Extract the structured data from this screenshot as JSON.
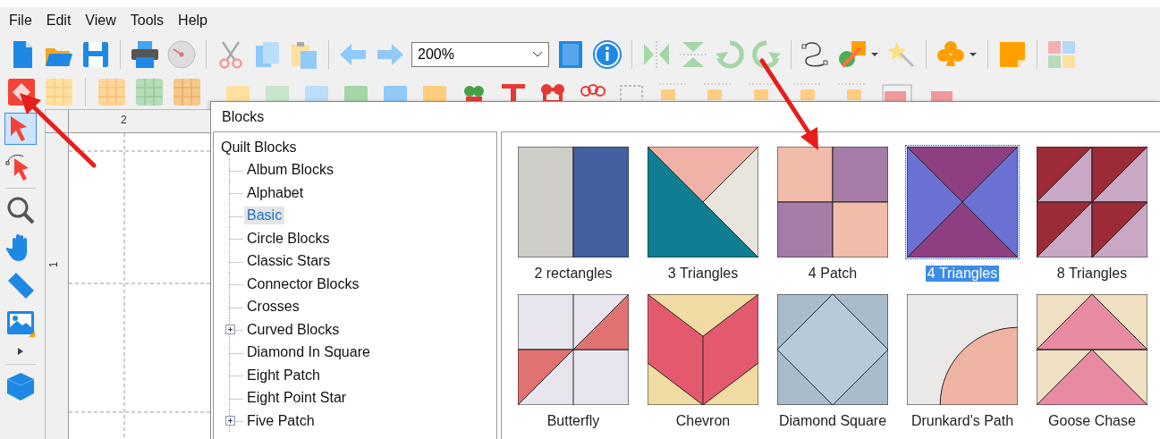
{
  "menu": [
    "File",
    "Edit",
    "View",
    "Tools",
    "Help"
  ],
  "zoom": {
    "value": "200%"
  },
  "tools": [
    {
      "kind": "select",
      "selected": true
    },
    {
      "kind": "node",
      "selected": false
    },
    {
      "kind": "zoom",
      "selected": false
    },
    {
      "kind": "hand",
      "selected": false
    },
    {
      "kind": "ruler",
      "selected": false
    },
    {
      "kind": "image",
      "selected": false
    },
    {
      "kind": "more",
      "selected": false
    },
    {
      "kind": "cube",
      "selected": false
    }
  ],
  "ruler": {
    "top_label": "2",
    "side_label": "1"
  },
  "blocks_panel": {
    "title": "Blocks",
    "tree": {
      "label": "Quilt Blocks",
      "children": [
        {
          "label": "Album Blocks",
          "kind": "leaf",
          "selected": false
        },
        {
          "label": "Alphabet",
          "kind": "leaf",
          "selected": false
        },
        {
          "label": "Basic",
          "kind": "leaf",
          "selected": true
        },
        {
          "label": "Circle Blocks",
          "kind": "leaf",
          "selected": false
        },
        {
          "label": "Classic Stars",
          "kind": "leaf",
          "selected": false
        },
        {
          "label": "Connector Blocks",
          "kind": "leaf",
          "selected": false
        },
        {
          "label": "Crosses",
          "kind": "leaf",
          "selected": false
        },
        {
          "label": "Curved Blocks",
          "kind": "folder",
          "selected": false
        },
        {
          "label": "Diamond In Square",
          "kind": "leaf",
          "selected": false
        },
        {
          "label": "Eight Patch",
          "kind": "leaf",
          "selected": false
        },
        {
          "label": "Eight Point Star",
          "kind": "leaf",
          "selected": false
        },
        {
          "label": "Five Patch",
          "kind": "folder",
          "selected": false
        }
      ]
    },
    "blocks": [
      {
        "name": "2 rectangles",
        "kind": "bars",
        "selected": false
      },
      {
        "name": "3 Triangles",
        "kind": "triangles",
        "selected": false
      },
      {
        "name": "4 Patch",
        "kind": "fourpatch",
        "selected": false
      },
      {
        "name": "4 Triangles",
        "kind": "hourglass",
        "selected": true
      },
      {
        "name": "8 Triangles",
        "kind": "halfsquares",
        "selected": false
      },
      {
        "name": "Butterfly",
        "kind": "butterfly",
        "selected": false
      },
      {
        "name": "Chevron",
        "kind": "chevron",
        "selected": false
      },
      {
        "name": "Diamond Square",
        "kind": "diamond",
        "selected": false
      },
      {
        "name": "Drunkard's Path",
        "kind": "drunkard",
        "selected": false
      },
      {
        "name": "Goose Chase",
        "kind": "geese",
        "selected": false
      }
    ]
  }
}
